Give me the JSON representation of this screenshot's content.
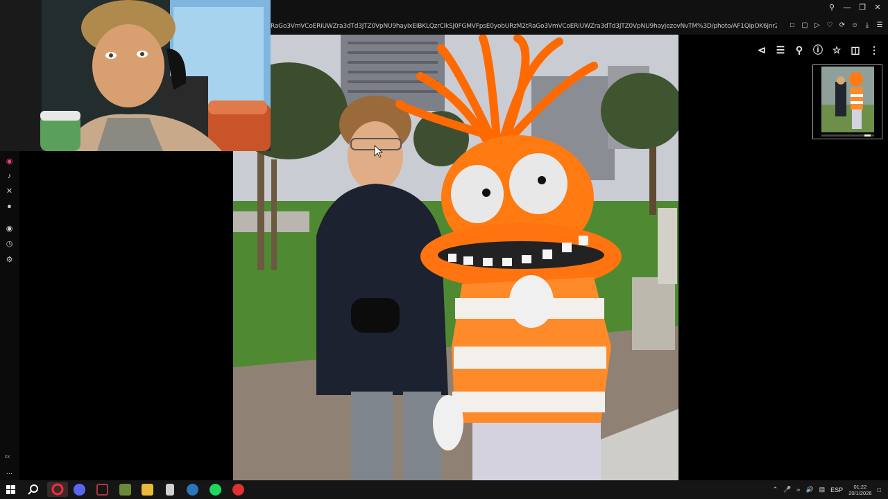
{
  "browser": {
    "url": "RaGo3VmVCoERiUWZra3dTd3JTZ0VpNU9hayIxEiBKLQzrCikSJ0FGMVFpsE0yobURzM2tRaGo3VmVCoERiUWZra3dTd3JTZ0VpNU9hayjezovNvTM%3D/photo/AF1QipOK6jnr26F_K",
    "window_controls": [
      "search-icon",
      "minimize-icon",
      "restore-icon",
      "close-icon"
    ],
    "url_icons": [
      "bookmark-icon",
      "pip-icon",
      "play-icon",
      "heart-icon",
      "extension-icon",
      "download-icon",
      "menu-icon"
    ]
  },
  "viewer": {
    "toolbar_icons": [
      "share-icon",
      "adjust-icon",
      "zoom-icon",
      "info-icon",
      "star-icon",
      "trash-icon",
      "more-icon"
    ]
  },
  "app_sidebar": {
    "icons": [
      "instagram-icon",
      "tiktok-icon",
      "x-icon",
      "discord-icon",
      "spotify-icon",
      "clock-icon",
      "settings-icon"
    ],
    "bottom_label": "cx",
    "more_label": "..."
  },
  "taskbar": {
    "apps": [
      "windows-start-icon",
      "search-icon",
      "opera-icon",
      "discord-icon",
      "vscode-icon",
      "minecraft-icon",
      "explorer-icon",
      "app-icon",
      "steam-icon",
      "spotify-icon",
      "obs-icon"
    ],
    "tray": {
      "language": "ESP",
      "time": "01:22",
      "date": "20/1/2026"
    }
  },
  "colors": {
    "accent_orange": "#ff7a10",
    "taskbar_bg": "#151515",
    "chrome_bg": "#111111"
  }
}
